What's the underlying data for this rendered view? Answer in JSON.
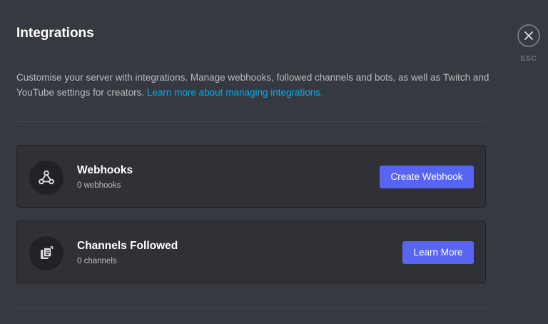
{
  "header": {
    "title": "Integrations",
    "description": "Customise your server with integrations. Manage webhooks, followed channels and bots, as well as Twitch and YouTube settings for creators.",
    "learn_more_link": "Learn more about managing integrations."
  },
  "close": {
    "esc_label": "ESC",
    "icon": "close-icon"
  },
  "cards": {
    "webhooks": {
      "icon": "webhook-icon",
      "title": "Webhooks",
      "subtitle": "0 webhooks",
      "button_label": "Create Webhook"
    },
    "channels": {
      "icon": "channel-follow-icon",
      "title": "Channels Followed",
      "subtitle": "0 channels",
      "button_label": "Learn More"
    }
  },
  "colors": {
    "background": "#36393f",
    "card_background": "#2f3136",
    "accent": "#5865f2",
    "link": "#00aff4"
  }
}
